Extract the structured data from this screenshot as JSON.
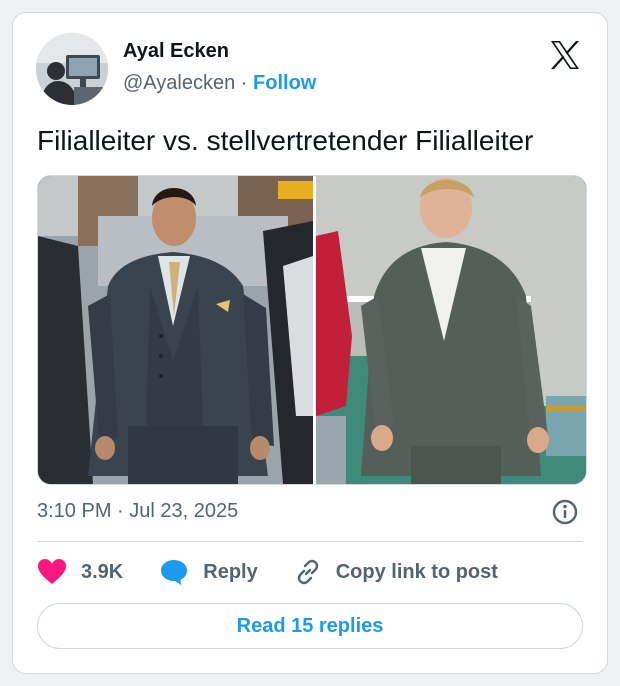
{
  "author": {
    "name": "Ayal Ecken",
    "handle": "@Ayalecken",
    "separator": "·",
    "follow_label": "Follow"
  },
  "brand_logo": "x-logo-icon",
  "tweet": {
    "text": "Filialleiter vs. stellvertretender Filialleiter",
    "timestamp": "3:10 PM · Jul 23, 2025"
  },
  "media": {
    "images": [
      "man-in-tailored-three-piece-suit-photo",
      "man-in-ill-fitting-suit-photo"
    ]
  },
  "actions": {
    "like_count": "3.9K",
    "reply_label": "Reply",
    "copy_label": "Copy link to post"
  },
  "read_replies_label": "Read 15 replies",
  "colors": {
    "accent": "#1d9bf0",
    "like": "#f91880",
    "muted": "#536471",
    "border": "#cfd9de"
  }
}
